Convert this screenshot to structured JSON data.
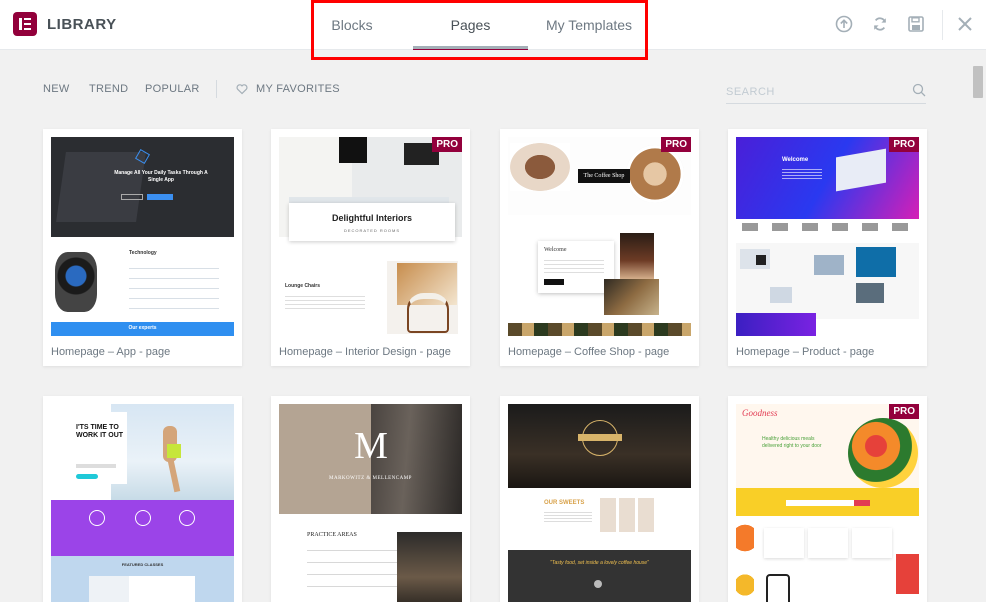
{
  "header": {
    "app_title": "LIBRARY",
    "tabs": [
      {
        "label": "Blocks",
        "active": false
      },
      {
        "label": "Pages",
        "active": true
      },
      {
        "label": "My Templates",
        "active": false
      }
    ],
    "icons": [
      "upload-icon",
      "sync-icon",
      "save-icon",
      "close-icon"
    ]
  },
  "toolbar": {
    "filters": [
      "NEW",
      "TREND",
      "POPULAR"
    ],
    "favorites_label": "MY FAVORITES",
    "search_placeholder": "SEARCH"
  },
  "templates": [
    {
      "title": "Homepage – App - page",
      "pro": false
    },
    {
      "title": "Homepage – Interior Design - page",
      "pro": true,
      "badge": "PRO"
    },
    {
      "title": "Homepage – Coffee Shop - page",
      "pro": true,
      "badge": "PRO"
    },
    {
      "title": "Homepage – Product - page",
      "pro": true,
      "badge": "PRO"
    },
    {
      "title": "",
      "pro": false
    },
    {
      "title": "",
      "pro": false
    },
    {
      "title": "",
      "pro": false
    },
    {
      "title": "",
      "pro": true,
      "badge": "PRO"
    }
  ],
  "previews": {
    "app": {
      "headline": "Manage All Your Daily Tasks Through A Single App",
      "section": "Technology",
      "footer": "Our experts"
    },
    "interior": {
      "headline": "Delightful Interiors",
      "sub": "DECORATED ROOMS",
      "section": "Lounge Chairs"
    },
    "coffee": {
      "headline": "The Coffee Shop",
      "section": "Welcome"
    },
    "product": {
      "headline": "Welcome"
    },
    "fitness": {
      "headline": "I'TS TIME TO WORK IT OUT",
      "section": "FEATURED CLASSES"
    },
    "law": {
      "logo": "M",
      "name": "MARKOWITZ & MELLENCAMP",
      "section": "PRACTICE AREAS"
    },
    "restaurant": {
      "section": "OUR SWEETS",
      "quote": "\"Tasty food, set inside a lovely coffee house\""
    },
    "food": {
      "logo": "Goodness",
      "headline": "Healthy delicious meals delivered right to your door"
    }
  },
  "colors": {
    "brand": "#93003c",
    "highlight_box": "#ff0000"
  }
}
